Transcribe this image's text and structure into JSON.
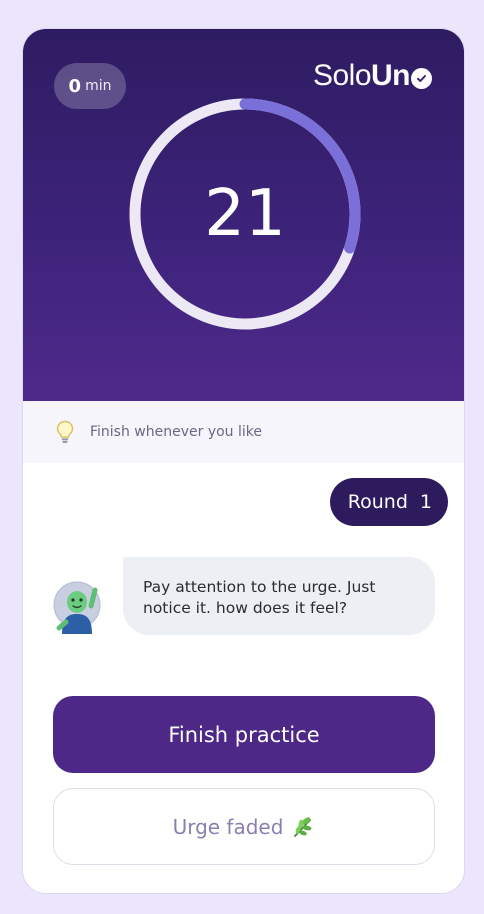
{
  "timer": {
    "minutes_value": "0",
    "minutes_unit": "min",
    "count": "21",
    "progress_fraction": 0.3
  },
  "logo": {
    "part_light": "Solo",
    "part_bold": "Un"
  },
  "tip": {
    "text": "Finish whenever you like",
    "icon": "lightbulb-icon"
  },
  "round": {
    "label": "Round",
    "number": "1"
  },
  "message": {
    "line1": "Pay attention to the urge. Just",
    "line2": "notice it. how does it feel?",
    "avatar_icon": "waving-character-avatar"
  },
  "buttons": {
    "finish_label": "Finish practice",
    "faded_label": "Urge faded",
    "faded_icon": "leaf-icon"
  },
  "colors": {
    "accent": "#4d2887",
    "ring_progress": "#7b6fd9",
    "ring_track": "#ece9f5",
    "round_pill": "#2e1b5e"
  }
}
